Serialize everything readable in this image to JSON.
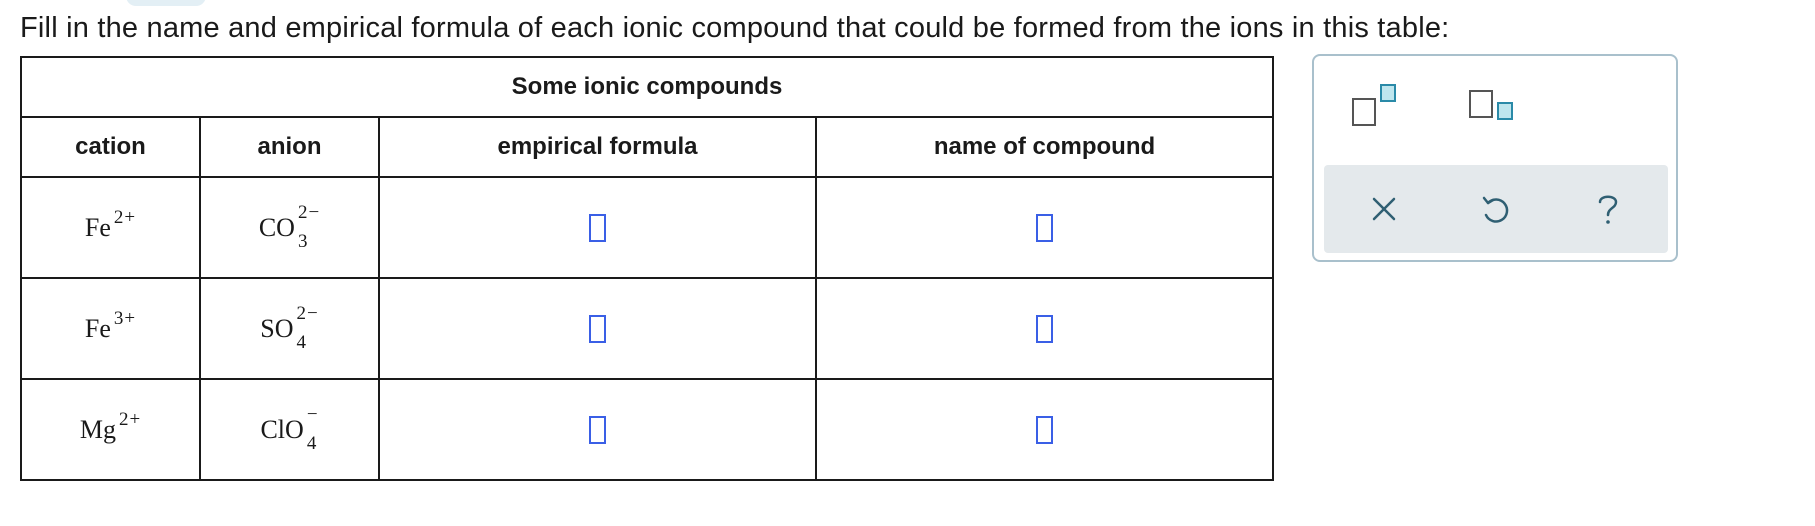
{
  "prompt": "Fill in the name and empirical formula of each ionic compound that could be formed from the ions in this table:",
  "table": {
    "caption": "Some ionic compounds",
    "headers": [
      "cation",
      "anion",
      "empirical formula",
      "name of compound"
    ],
    "rows": [
      {
        "cation": {
          "symbol": "Fe",
          "charge": "2+"
        },
        "anion": {
          "symbol": "CO",
          "subscript": "3",
          "charge": "2−"
        },
        "empirical_formula": "",
        "name_of_compound": ""
      },
      {
        "cation": {
          "symbol": "Fe",
          "charge": "3+"
        },
        "anion": {
          "symbol": "SO",
          "subscript": "4",
          "charge": "2−"
        },
        "empirical_formula": "",
        "name_of_compound": ""
      },
      {
        "cation": {
          "symbol": "Mg",
          "charge": "2+"
        },
        "anion": {
          "symbol": "ClO",
          "subscript": "4",
          "charge": "−"
        },
        "empirical_formula": "",
        "name_of_compound": ""
      }
    ]
  },
  "toolbar": {
    "superscript_icon": "superscript-box-icon",
    "subscript_icon": "subscript-box-icon",
    "clear_icon": "x-icon",
    "undo_icon": "undo-icon",
    "help_icon": "question-icon"
  },
  "colors": {
    "answer_box_border": "#3a5fe6",
    "toolbar_accent": "#2a8aa8",
    "toolbar_action_bg": "#e4e9ec",
    "panel_border": "#a9c0cc"
  }
}
